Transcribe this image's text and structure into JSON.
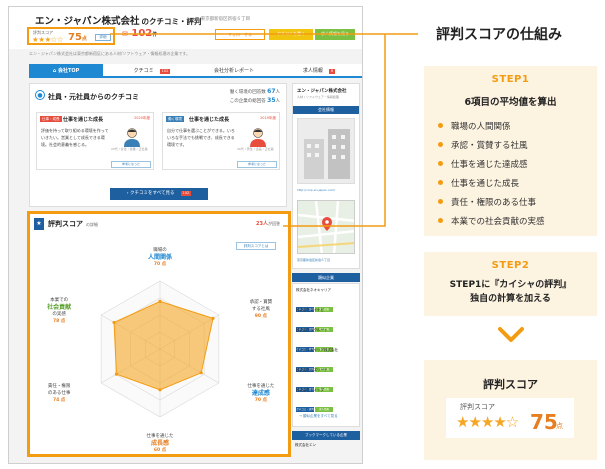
{
  "header": {
    "company_name": "エン・ジャパン株式会社",
    "company_suffix": "のクチコミ・評判",
    "address": "■ 東京都新宿区新宿６丁目",
    "score_label": "評判スコア",
    "score_stars": "★★★☆☆",
    "score_value": "75",
    "score_unit": "点",
    "score_button": "詳細",
    "review_icon": "✉",
    "review_count": "102",
    "review_unit": "件",
    "btn_follow": "フォローする",
    "btn_write": "クチコミを書く",
    "btn_apply": "求人情報を見る",
    "intro": "エン・ジャパン株式会社は東京都新宿区にある人材/ソフトウェア・情報処理の企業です。"
  },
  "tabs": [
    {
      "label": "会社TOP"
    },
    {
      "label": "クチコミ",
      "badge": "102"
    },
    {
      "label": "会社分析レポート"
    },
    {
      "label": "求人情報",
      "badge": "6"
    }
  ],
  "reviews_panel": {
    "title": "社員・元社員からのクチコミ",
    "stat1_label": "働く環境の回答数",
    "stat1_value": "67",
    "stat1_unit": "人",
    "stat2_label": "この企業の総回答",
    "stat2_value": "35",
    "stat2_unit": "人",
    "cards": [
      {
        "tag": "仕事・成長",
        "head": "仕事を通じた成長",
        "date": "2020年度",
        "body": "評価を持って取り組める環境を作っていきたい。営業として成長できる環境。社会的意義を感じる。",
        "meta": "20代 / 女性 / 営業 / 正社員",
        "vote": "参考になった"
      },
      {
        "tag": "働く環境",
        "head": "仕事を通じた成長",
        "date": "2019年度",
        "body": "自分で仕事を選ぶことができる。いろいろな手法でも挑戦でき、成長できる環境です。",
        "meta": "30代 / 男性 / 企画 / 正社員",
        "vote": "参考になった"
      }
    ],
    "all_button": "クチコミをすべて見る",
    "all_badge": "102"
  },
  "score_panel": {
    "title": "評判スコア",
    "title_sub": "の詳細",
    "count": "23人",
    "count_sub": "が回答",
    "help": "評判スコアとは",
    "axes": [
      {
        "top": "職場の",
        "main": "人間関係",
        "score": "70",
        "color": "#1e88d2"
      },
      {
        "top": "承認・賞賛",
        "main": "",
        "sub": "する社風",
        "score": "90",
        "color": "#e67e22"
      },
      {
        "top": "仕事を通じた",
        "main": "達成感",
        "score": "70",
        "color": "#1e88d2"
      },
      {
        "top": "仕事を通じた",
        "main": "成長感",
        "score": "60",
        "color": "#e67e22"
      },
      {
        "top": "責任・権限",
        "main": "",
        "sub": "のある仕事",
        "score": "74",
        "color": "#7b4fb0"
      },
      {
        "top": "本業での",
        "main": "社会貢献",
        "sub": "の実感",
        "score": "78",
        "color": "#5aa02c"
      }
    ],
    "score_unit": "点",
    "max_score": 100
  },
  "sidebar": {
    "company": "エン・ジャパン株式会社",
    "industry": "人材 / ソフトウェア・情報処理",
    "header": "会社情報",
    "url": "http://corp.en-japan.com/",
    "address": "東京都新宿区新宿６丁目",
    "related_header": "類似企業",
    "related": [
      {
        "name": "株式会社ネオキャリア"
      },
      {
        "name": "株式会社マイナビ"
      },
      {
        "name": "株式会社リクルート"
      },
      {
        "name": "パーソルキャリア株式会社"
      },
      {
        "name": "株式会社ビズリーチ"
      },
      {
        "name": "株式会社ディップ"
      }
    ],
    "chip_review": "クチコミ・評判",
    "chip_job": "求人情報",
    "related_more": "→ 類似企業をすべて見る",
    "bookmark_header": "ブックマークしている企業",
    "bookmark_item": "株式会社エン"
  },
  "explain": {
    "title": "評判スコアの仕組み",
    "step1_label": "STEP1",
    "step1_sub": "6項目の平均値を算出",
    "items": [
      "職場の人間関係",
      "承認・賞賛する社風",
      "仕事を通じた達成感",
      "仕事を通じた成長",
      "責任・権限のある仕事",
      "本業での社会貢献の実感"
    ],
    "step2_label": "STEP2",
    "step2_line1": "STEP1に『カイシャの評判』",
    "step2_line2": "独自の計算を加える",
    "result_title": "評判スコア",
    "result_label": "評判スコア",
    "result_stars": "★★★★☆",
    "result_value": "75",
    "result_unit": "点"
  },
  "colors": {
    "accent": "#f39c12",
    "primary": "#1e88d2",
    "navy": "#1e5fa0",
    "alert": "#e74c3c"
  }
}
